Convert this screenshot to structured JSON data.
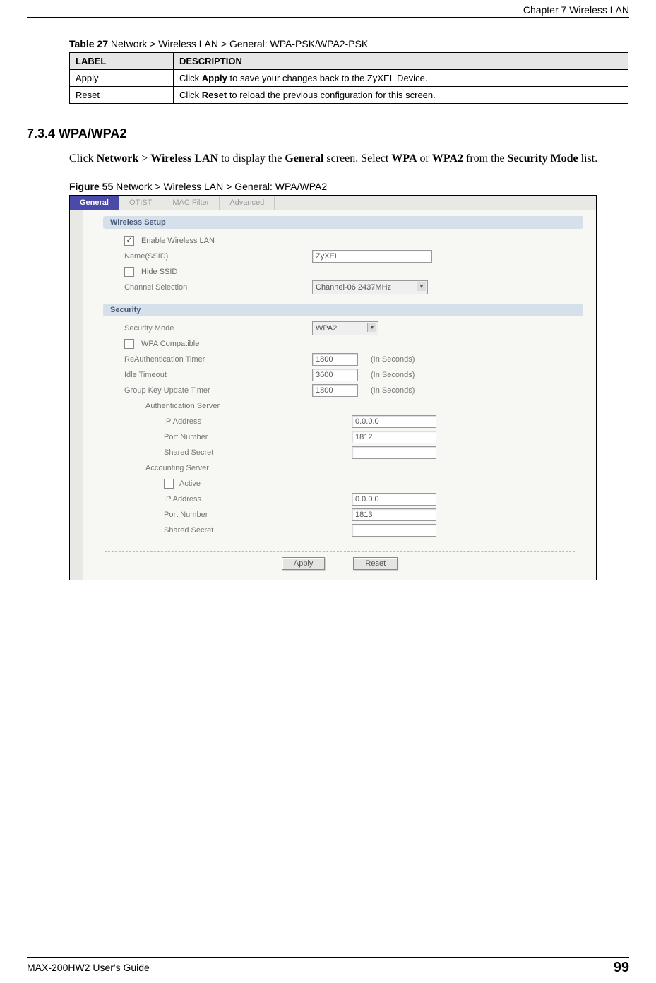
{
  "header": {
    "chapter": "Chapter 7 Wireless LAN"
  },
  "table27": {
    "caption_bold": "Table 27",
    "caption_rest": "   Network > Wireless LAN > General: WPA-PSK/WPA2-PSK",
    "head_label": "LABEL",
    "head_desc": "DESCRIPTION",
    "rows": [
      {
        "label": "Apply",
        "desc_pre": "Click ",
        "desc_bold": "Apply",
        "desc_post": " to save your changes back to the ZyXEL Device."
      },
      {
        "label": "Reset",
        "desc_pre": "Click ",
        "desc_bold": "Reset",
        "desc_post": " to reload the previous configuration for this screen."
      }
    ]
  },
  "section": {
    "number": "7.3.4  WPA/WPA2",
    "para_parts": [
      "Click ",
      "Network",
      " > ",
      "Wireless LAN",
      " to display the ",
      "General",
      " screen. Select ",
      "WPA",
      " or ",
      "WPA2",
      " from the ",
      "Security Mode",
      " list."
    ]
  },
  "figure": {
    "caption_bold": "Figure 55",
    "caption_rest": "   Network > Wireless LAN > General: WPA/WPA2"
  },
  "screenshot": {
    "tabs": [
      "General",
      "OTIST",
      "MAC Filter",
      "Advanced"
    ],
    "active_tab": 0,
    "section1": "Wireless Setup",
    "enable_wlan": {
      "label": "Enable Wireless LAN",
      "checked": true
    },
    "ssid": {
      "label": "Name(SSID)",
      "value": "ZyXEL"
    },
    "hide_ssid": {
      "label": "Hide SSID",
      "checked": false
    },
    "channel": {
      "label": "Channel Selection",
      "value": "Channel-06 2437MHz"
    },
    "section2": "Security",
    "sec_mode": {
      "label": "Security Mode",
      "value": "WPA2"
    },
    "wpa_compat": {
      "label": "WPA Compatible",
      "checked": false
    },
    "reauth": {
      "label": "ReAuthentication Timer",
      "value": "1800",
      "suffix": "(In Seconds)"
    },
    "idle": {
      "label": "Idle Timeout",
      "value": "3600",
      "suffix": "(In Seconds)"
    },
    "gkey": {
      "label": "Group Key Update Timer",
      "value": "1800",
      "suffix": "(In Seconds)"
    },
    "auth_server_hdr": "Authentication Server",
    "auth_ip": {
      "label": "IP Address",
      "value": "0.0.0.0"
    },
    "auth_port": {
      "label": "Port Number",
      "value": "1812"
    },
    "auth_secret": {
      "label": "Shared Secret",
      "value": ""
    },
    "acct_server_hdr": "Accounting Server",
    "acct_active": {
      "label": "Active",
      "checked": false
    },
    "acct_ip": {
      "label": "IP Address",
      "value": "0.0.0.0"
    },
    "acct_port": {
      "label": "Port Number",
      "value": "1813"
    },
    "acct_secret": {
      "label": "Shared Secret",
      "value": ""
    },
    "btn_apply": "Apply",
    "btn_reset": "Reset"
  },
  "footer": {
    "guide": "MAX-200HW2 User's Guide",
    "page": "99"
  }
}
